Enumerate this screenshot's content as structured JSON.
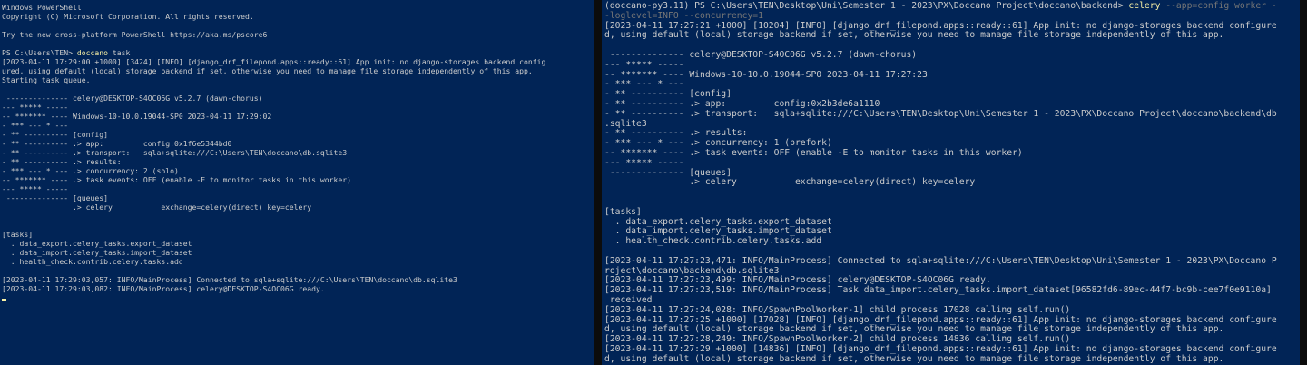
{
  "left_terminal": {
    "lines": [
      "Windows PowerShell",
      "Copyright (C) Microsoft Corporation. All rights reserved.",
      "",
      "Try the new cross-platform PowerShell https://aka.ms/pscore6",
      "",
      "@@PROMPT@@",
      "[2023-04-11 17:29:00 +1000] [3424] [INFO] [django_drf_filepond.apps::ready::61] App init: no django-storages backend config",
      "ured, using default (local) storage backend if set, otherwise you need to manage file storage independently of this app.",
      "Starting task queue.",
      "",
      " -------------- celery@DESKTOP-S4OC06G v5.2.7 (dawn-chorus)",
      "--- ***** -----",
      "-- ******* ---- Windows-10-10.0.19044-SP0 2023-04-11 17:29:02",
      "- *** --- * ---",
      "- ** ---------- [config]",
      "- ** ---------- .> app:         config:0x1f6e5344bd0",
      "- ** ---------- .> transport:   sqla+sqlite:///C:\\Users\\TEN\\doccano\\db.sqlite3",
      "- ** ---------- .> results:",
      "- *** --- * --- .> concurrency: 2 (solo)",
      "-- ******* ---- .> task events: OFF (enable -E to monitor tasks in this worker)",
      "--- ***** -----",
      " -------------- [queues]",
      "                .> celery           exchange=celery(direct) key=celery",
      "",
      "",
      "[tasks]",
      "  . data_export.celery_tasks.export_dataset",
      "  . data_import.celery_tasks.import_dataset",
      "  . health_check.contrib.celery.tasks.add",
      "",
      "[2023-04-11 17:29:03,057: INFO/MainProcess] Connected to sqla+sqlite:///C:\\Users\\TEN\\doccano\\db.sqlite3",
      "[2023-04-11 17:29:03,082: INFO/MainProcess] celery@DESKTOP-S4OC06G ready."
    ],
    "prompt": {
      "text": "PS C:\\Users\\TEN> ",
      "command": "doccano",
      "args": " task"
    }
  },
  "right_terminal": {
    "prompt": {
      "text": "(doccano-py3.11) PS C:\\Users\\TEN\\Desktop\\Uni\\Semester 1 - 2023\\PX\\Doccano Project\\doccano\\backend> ",
      "command": "celery",
      "args_line1": " --app=config worker -",
      "args_line2": "-loglevel=INFO --concurrency=1"
    },
    "lines": [
      "[2023-04-11 17:27:21 +1000] [10204] [INFO] [django_drf_filepond.apps::ready::61] App init: no django-storages backend configure",
      "d, using default (local) storage backend if set, otherwise you need to manage file storage independently of this app.",
      "",
      " -------------- celery@DESKTOP-S4OC06G v5.2.7 (dawn-chorus)",
      "--- ***** -----",
      "-- ******* ---- Windows-10-10.0.19044-SP0 2023-04-11 17:27:23",
      "- *** --- * ---",
      "- ** ---------- [config]",
      "- ** ---------- .> app:         config:0x2b3de6a1110",
      "- ** ---------- .> transport:   sqla+sqlite:///C:\\Users\\TEN\\Desktop\\Uni\\Semester 1 - 2023\\PX\\Doccano Project\\doccano\\backend\\db",
      ".sqlite3",
      "- ** ---------- .> results:",
      "- *** --- * --- .> concurrency: 1 (prefork)",
      "-- ******* ---- .> task events: OFF (enable -E to monitor tasks in this worker)",
      "--- ***** -----",
      " -------------- [queues]",
      "                .> celery           exchange=celery(direct) key=celery",
      "",
      "",
      "[tasks]",
      "  . data_export.celery_tasks.export_dataset",
      "  . data_import.celery_tasks.import_dataset",
      "  . health_check.contrib.celery.tasks.add",
      "",
      "[2023-04-11 17:27:23,471: INFO/MainProcess] Connected to sqla+sqlite:///C:\\Users\\TEN\\Desktop\\Uni\\Semester 1 - 2023\\PX\\Doccano P",
      "roject\\doccano\\backend\\db.sqlite3",
      "[2023-04-11 17:27:23,499: INFO/MainProcess] celery@DESKTOP-S4OC06G ready.",
      "[2023-04-11 17:27:23,519: INFO/MainProcess] Task data_import.celery_tasks.import_dataset[96582fd6-89ec-44f7-bc9b-cee7f0e9110a]",
      " received",
      "[2023-04-11 17:27:24,028: INFO/SpawnPoolWorker-1] child process 17028 calling self.run()",
      "[2023-04-11 17:27:25 +1000] [17028] [INFO] [django_drf_filepond.apps::ready::61] App init: no django-storages backend configure",
      "d, using default (local) storage backend if set, otherwise you need to manage file storage independently of this app.",
      "[2023-04-11 17:27:28,249: INFO/SpawnPoolWorker-2] child process 14836 calling self.run()",
      "[2023-04-11 17:27:29 +1000] [14836] [INFO] [django_drf_filepond.apps::ready::61] App init: no django-storages backend configure",
      "d, using default (local) storage backend if set, otherwise you need to manage file storage independently of this app."
    ]
  },
  "colors": {
    "background": "#012456",
    "text": "#cccccc",
    "command": "#f9f1a5",
    "argument": "#767676",
    "divider": "#0c0c0c"
  }
}
